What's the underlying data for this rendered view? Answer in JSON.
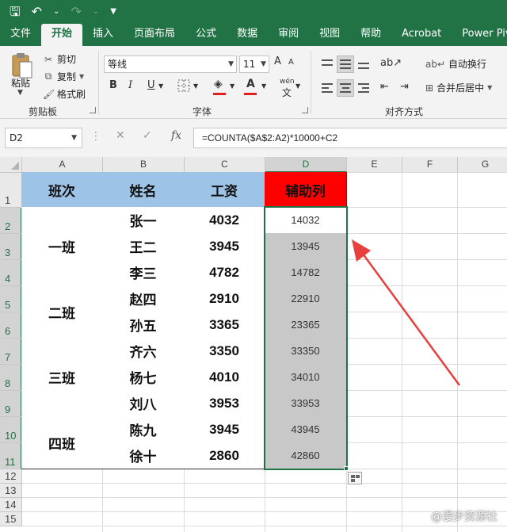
{
  "quick_access": {
    "save": "🖫",
    "undo": "↶",
    "undo_dd": "⌄",
    "redo": "↷",
    "redo_dd": "⌄",
    "customize": "▼"
  },
  "tabs": [
    "文件",
    "开始",
    "插入",
    "页面布局",
    "公式",
    "数据",
    "审阅",
    "视图",
    "帮助",
    "Acrobat",
    "Power Pivot"
  ],
  "active_tab": 1,
  "ribbon": {
    "clipboard": {
      "paste": "粘贴",
      "cut": "剪切",
      "copy": "复制",
      "format_painter": "格式刷",
      "label": "剪贴板"
    },
    "font": {
      "name": "等线",
      "size": "11",
      "grow": "A",
      "shrink": "A",
      "bold": "B",
      "italic": "I",
      "underline": "U",
      "label": "字体",
      "wen": "wén"
    },
    "alignment": {
      "wrap_text": "自动换行",
      "merge_center": "合并后居中",
      "label": "对齐方式"
    }
  },
  "formula_bar": {
    "name_box": "D2",
    "cancel": "✕",
    "enter": "✓",
    "fx": "fx",
    "formula": "=COUNTA($A$2:A2)*10000+C2"
  },
  "columns": [
    "A",
    "B",
    "C",
    "D",
    "E",
    "F",
    "G"
  ],
  "rows": [
    "1",
    "2",
    "3",
    "4",
    "5",
    "6",
    "7",
    "8",
    "9",
    "10",
    "11",
    "12",
    "13",
    "14",
    "15"
  ],
  "sheet": {
    "headers": {
      "class": "班次",
      "name": "姓名",
      "salary": "工资",
      "helper": "辅助列"
    },
    "groups": [
      {
        "label": "一班",
        "rows": 3
      },
      {
        "label": "二班",
        "rows": 2
      },
      {
        "label": "三班",
        "rows": 3
      },
      {
        "label": "四班",
        "rows": 2
      }
    ],
    "records": [
      {
        "name": "张一",
        "salary": "4032",
        "helper": "14032"
      },
      {
        "name": "王二",
        "salary": "3945",
        "helper": "13945"
      },
      {
        "name": "李三",
        "salary": "4782",
        "helper": "14782"
      },
      {
        "name": "赵四",
        "salary": "2910",
        "helper": "22910"
      },
      {
        "name": "孙五",
        "salary": "3365",
        "helper": "23365"
      },
      {
        "name": "齐六",
        "salary": "3350",
        "helper": "33350"
      },
      {
        "name": "杨七",
        "salary": "4010",
        "helper": "34010"
      },
      {
        "name": "刘八",
        "salary": "3953",
        "helper": "33953"
      },
      {
        "name": "陈九",
        "salary": "3945",
        "helper": "43945"
      },
      {
        "name": "徐十",
        "salary": "2860",
        "helper": "42860"
      }
    ]
  },
  "colors": {
    "excel_green": "#217346",
    "header_blue": "#9dc3e6",
    "header_red": "#ff0000",
    "helper_gray": "#c8c8c8",
    "arrow_red": "#e8403c"
  },
  "watermark": "@漫步资源社"
}
